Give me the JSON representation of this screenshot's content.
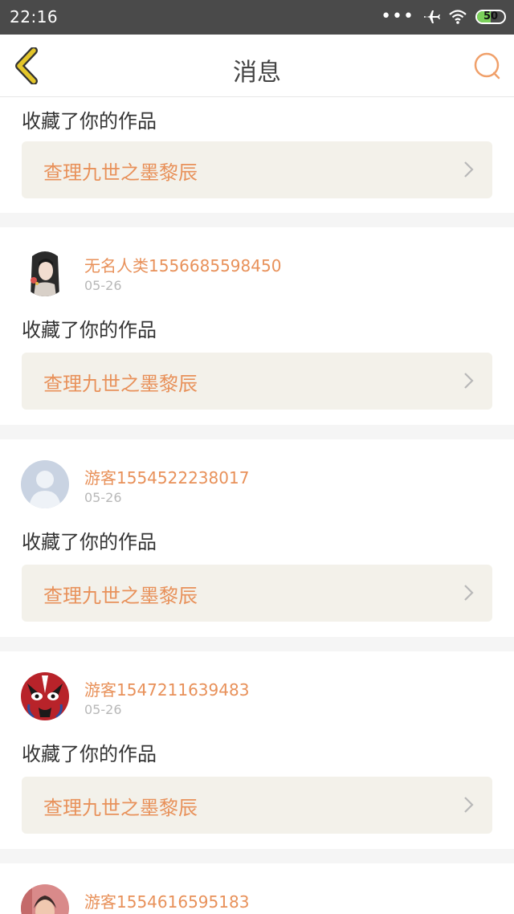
{
  "status_bar": {
    "time": "22:16",
    "battery": "50"
  },
  "header": {
    "title": "消息"
  },
  "cards": [
    {
      "action": "收藏了你的作品",
      "work_title": "查理九世之墨黎辰"
    },
    {
      "user": "无名人类1556685598450",
      "time": "05-26",
      "action": "收藏了你的作品",
      "work_title": "查理九世之墨黎辰"
    },
    {
      "user": "游客1554522238017",
      "time": "05-26",
      "action": "收藏了你的作品",
      "work_title": "查理九世之墨黎辰"
    },
    {
      "user": "游客1547211639483",
      "time": "05-26",
      "action": "收藏了你的作品",
      "work_title": "查理九世之墨黎辰"
    },
    {
      "user": "游客1554616595183"
    }
  ],
  "colors": {
    "accent": "#e8915a",
    "nav_back": "#e0c020",
    "card_bg": "#ffffff",
    "link_bg": "#f3f1ea"
  }
}
